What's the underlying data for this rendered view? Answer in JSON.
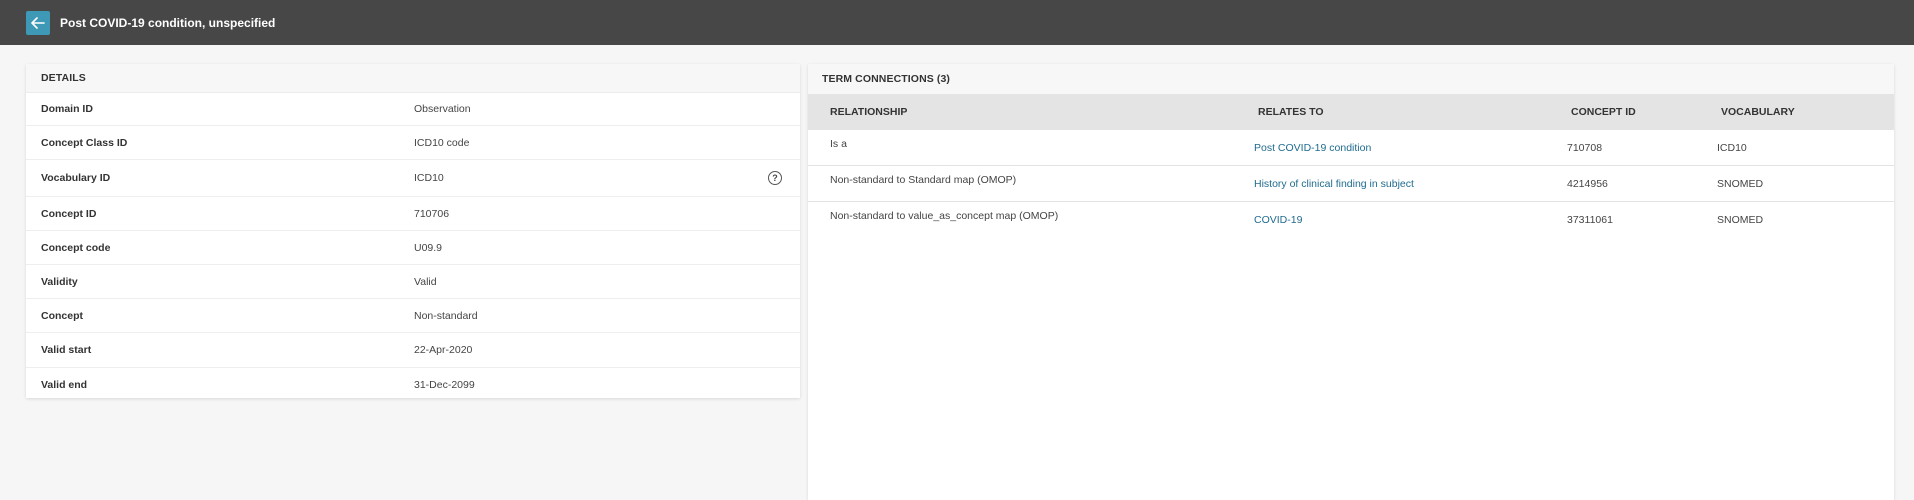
{
  "header": {
    "title": "Post COVID-19 condition, unspecified",
    "back_icon": "arrow-left-icon",
    "bar_color": "#474747",
    "accent_color": "#3d99b5"
  },
  "details": {
    "title": "DETAILS",
    "rows": [
      {
        "label": "Domain ID",
        "value": "Observation"
      },
      {
        "label": "Concept Class ID",
        "value": "ICD10 code"
      },
      {
        "label": "Vocabulary ID",
        "value": "ICD10",
        "help_icon": "question-circle-icon"
      },
      {
        "label": "Concept ID",
        "value": "710706"
      },
      {
        "label": "Concept code",
        "value": "U09.9"
      },
      {
        "label": "Validity",
        "value": "Valid"
      },
      {
        "label": "Concept",
        "value": "Non-standard"
      },
      {
        "label": "Valid start",
        "value": "22-Apr-2020"
      },
      {
        "label": "Valid end",
        "value": "31-Dec-2099"
      }
    ]
  },
  "term_connections": {
    "title": "TERM CONNECTIONS (3)",
    "columns": [
      "RELATIONSHIP",
      "RELATES TO",
      "CONCEPT ID",
      "VOCABULARY"
    ],
    "rows": [
      {
        "relationship": "Is a",
        "relates_to": "Post COVID-19 condition",
        "concept_id": "710708",
        "vocabulary": "ICD10"
      },
      {
        "relationship": "Non-standard to Standard map (OMOP)",
        "relates_to": "History of clinical finding in subject",
        "concept_id": "4214956",
        "vocabulary": "SNOMED"
      },
      {
        "relationship": "Non-standard to value_as_concept map (OMOP)",
        "relates_to": "COVID-19",
        "concept_id": "37311061",
        "vocabulary": "SNOMED"
      }
    ],
    "link_color": "#1f6b8f"
  }
}
